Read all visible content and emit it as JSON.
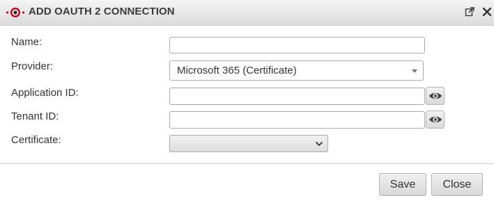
{
  "dialog": {
    "title": "ADD OAUTH 2 CONNECTION"
  },
  "icons": {
    "logo": "logo-icon",
    "popout": "external-link-icon",
    "close": "close-icon",
    "reveal": "eye-icon",
    "dropdown": "chevron-down-icon"
  },
  "form": {
    "name_label": "Name:",
    "name_value": "",
    "provider_label": "Provider:",
    "provider_value": "Microsoft 365 (Certificate)",
    "application_id_label": "Application ID:",
    "application_id_value": "",
    "tenant_id_label": "Tenant ID:",
    "tenant_id_value": "",
    "certificate_label": "Certificate:",
    "certificate_value": ""
  },
  "buttons": {
    "save": "Save",
    "close": "Close"
  },
  "colors": {
    "brand_red": "#d0021b",
    "titlebar": "#e3e3e3",
    "border": "#a9a9a9"
  }
}
